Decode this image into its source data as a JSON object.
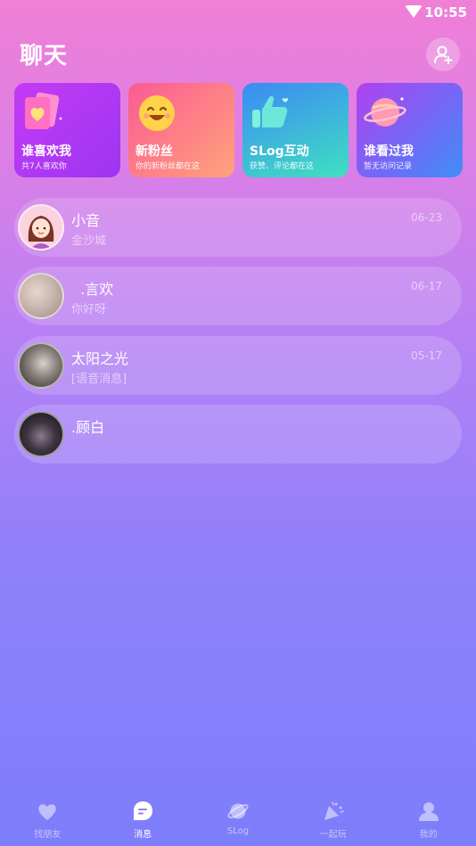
{
  "status_bar": {
    "time": "10:55"
  },
  "header": {
    "title": "聊天"
  },
  "cards": [
    {
      "title": "谁喜欢我",
      "subtitle": "共7人喜欢你"
    },
    {
      "title": "新粉丝",
      "subtitle": "你的新粉丝都在这"
    },
    {
      "title": "SLog互动",
      "subtitle": "获赞、评论都在这"
    },
    {
      "title": "谁看过我",
      "subtitle": "暂无访问记录"
    }
  ],
  "chats": [
    {
      "name": "小音",
      "preview": "金沙城",
      "time": "06-23"
    },
    {
      "name": "  .言欢",
      "preview": "你好呀",
      "time": "06-17"
    },
    {
      "name": "太阳之光",
      "preview": "[语音消息]",
      "time": "05-17"
    },
    {
      "name": ".顾白",
      "preview": "",
      "time": ""
    }
  ],
  "tabs": [
    {
      "label": "找朋友",
      "icon": "heart-icon"
    },
    {
      "label": "消息",
      "icon": "message-icon"
    },
    {
      "label": "SLog",
      "icon": "planet-icon"
    },
    {
      "label": "一起玩",
      "icon": "party-icon"
    },
    {
      "label": "我的",
      "icon": "profile-icon"
    }
  ]
}
